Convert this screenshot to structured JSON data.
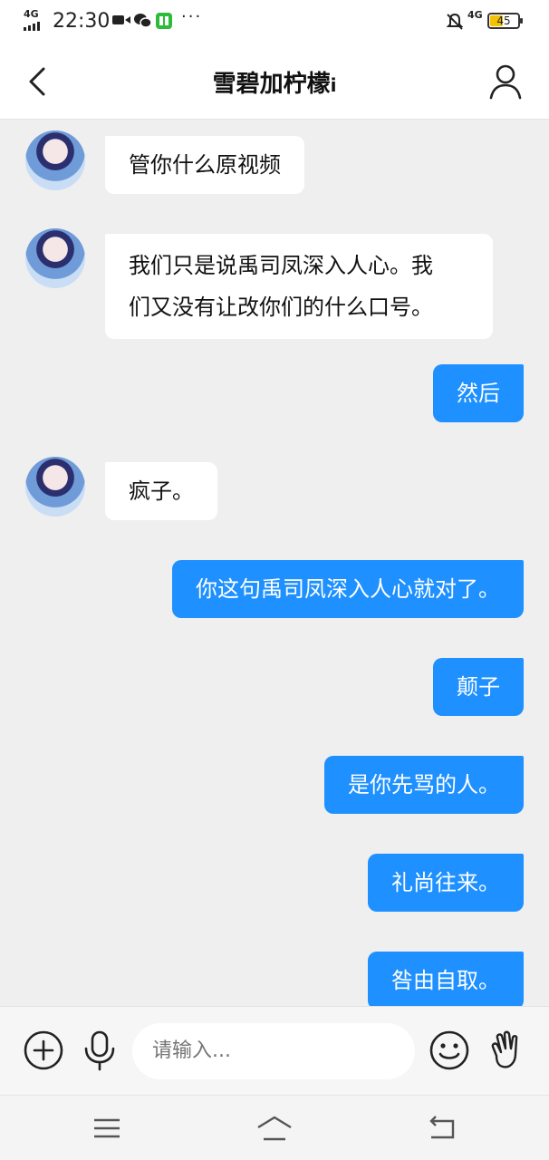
{
  "status_bar": {
    "network": "4G",
    "time": "22:30",
    "network_right": "4G",
    "battery": "45",
    "battery_level_percent": 45,
    "icons": [
      "video-icon",
      "wechat-icon",
      "reader-app-icon",
      "more-dots-icon",
      "mute-bell-icon"
    ]
  },
  "header": {
    "title": "雪碧加柠檬",
    "title_suffix": "i",
    "back_icon": "chevron-left-icon",
    "profile_icon": "user-profile-icon"
  },
  "messages": [
    {
      "side": "left",
      "text": "管你什么原视频"
    },
    {
      "side": "left",
      "text": "我们只是说禹司凤深入人心。我们又没有让改你们的什么口号。",
      "lines": [
        "我们只是说禹司凤深入人心。我",
        "们又没有让改你们的什么口号。"
      ]
    },
    {
      "side": "right",
      "text": "然后"
    },
    {
      "side": "left",
      "text": "疯子。"
    },
    {
      "side": "right",
      "text": "你这句禹司凤深入人心就对了。"
    },
    {
      "side": "right",
      "text": "颠子"
    },
    {
      "side": "right",
      "text": "是你先骂的人。"
    },
    {
      "side": "right",
      "text": "礼尚往来。"
    },
    {
      "side": "right",
      "text": "咎由自取。"
    }
  ],
  "input_bar": {
    "placeholder": "请输入...",
    "icons": [
      "plus-circle-icon",
      "microphone-icon",
      "smiley-icon",
      "hand-wave-icon"
    ]
  },
  "nav_bar": {
    "icons": [
      "menu-icon",
      "home-icon",
      "back-arrow-icon"
    ]
  },
  "colors": {
    "accent_blue": "#1e90ff",
    "background": "#efefef",
    "battery_fill": "#f3c300"
  }
}
